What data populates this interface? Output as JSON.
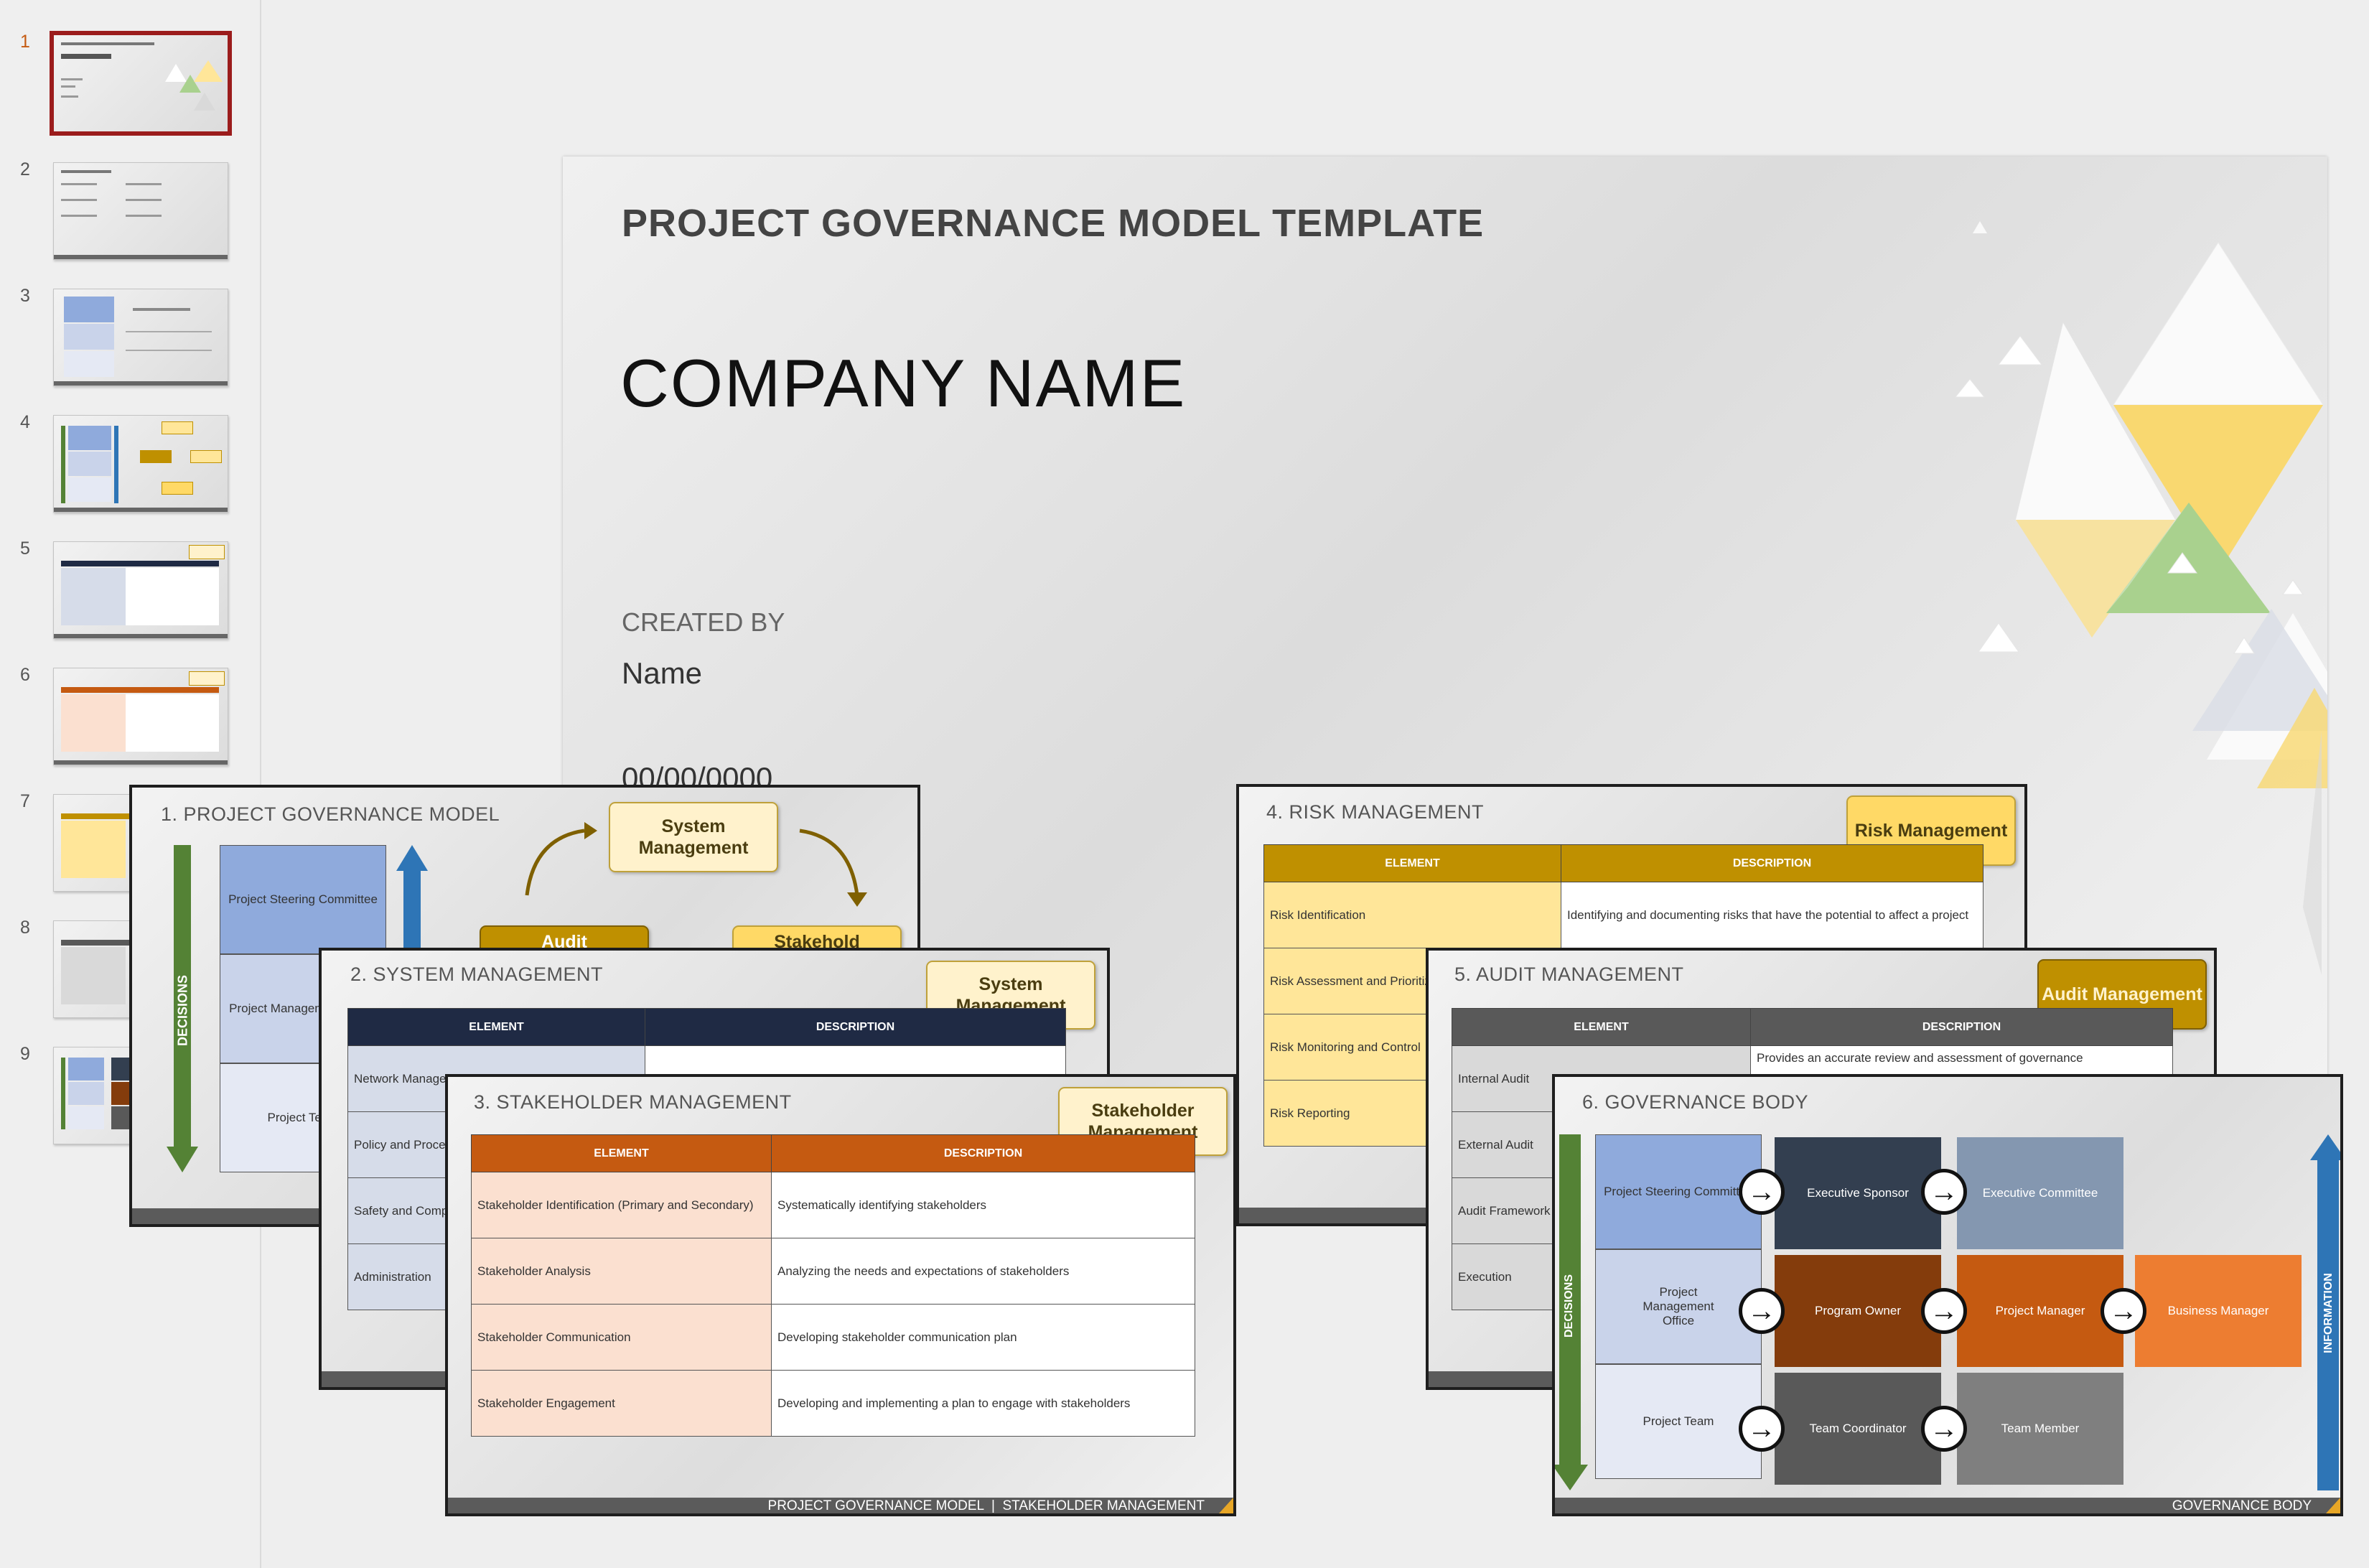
{
  "thumbnails": [
    {
      "num": "1",
      "selected": true,
      "title": "PROJECT GOVERNANCE MODEL TEMPLATE",
      "sub": "COMPANY NAME"
    },
    {
      "num": "2",
      "selected": false,
      "title": "TABLE OF CONTENTS"
    },
    {
      "num": "3",
      "selected": false,
      "title": "GOVERNANCE MODEL"
    },
    {
      "num": "4",
      "selected": false,
      "title": "PROJECT GOVERNANCE MODEL"
    },
    {
      "num": "5",
      "selected": false,
      "title": "SYSTEM MANAGEMENT"
    },
    {
      "num": "6",
      "selected": false,
      "title": "STAKEHOLDER MANAGEMENT"
    },
    {
      "num": "7",
      "selected": false,
      "title": "RISK MANAGEMENT"
    },
    {
      "num": "8",
      "selected": false,
      "title": "AUDIT MANAGEMENT"
    },
    {
      "num": "9",
      "selected": false,
      "title": "GOVERNANCE BODY"
    }
  ],
  "main_slide": {
    "title": "PROJECT GOVERNANCE MODEL TEMPLATE",
    "company": "COMPANY NAME",
    "created_by_label": "CREATED BY",
    "name": "Name",
    "date": "00/00/0000"
  },
  "s1": {
    "heading": "1. PROJECT GOVERNANCE MODEL",
    "decisions": "DECISIONS",
    "boxes": [
      "Project Steering Committee",
      "Project Management Office",
      "Project Team"
    ],
    "badge": "System Management",
    "gold1": "Audit",
    "gold2": "Stakehold"
  },
  "s2": {
    "heading": "2. SYSTEM MANAGEMENT",
    "badge": "System Management",
    "col1": "ELEMENT",
    "col2": "DESCRIPTION",
    "rows": [
      "Network Management",
      "Policy and Procedures",
      "Safety and Compliance",
      "Administration"
    ]
  },
  "s3": {
    "heading": "3. STAKEHOLDER MANAGEMENT",
    "badge": "Stakeholder Management",
    "col1": "ELEMENT",
    "col2": "DESCRIPTION",
    "rows": [
      {
        "e": "Stakeholder Identification (Primary and Secondary)",
        "d": "Systematically identifying stakeholders"
      },
      {
        "e": "Stakeholder Analysis",
        "d": "Analyzing the needs and expectations of stakeholders"
      },
      {
        "e": "Stakeholder Communication",
        "d": "Developing stakeholder communication plan"
      },
      {
        "e": "Stakeholder Engagement",
        "d": "Developing and implementing a plan to engage with stakeholders"
      }
    ],
    "footer": "PROJECT GOVERNANCE MODEL  |  STAKEHOLDER MANAGEMENT"
  },
  "s4": {
    "heading": "4. RISK MANAGEMENT",
    "badge": "Risk Management",
    "col1": "ELEMENT",
    "col2": "DESCRIPTION",
    "rows": [
      {
        "e": "Risk Identification",
        "d": "Identifying and documenting risks that have the potential to affect a project"
      },
      {
        "e": "Risk Assessment and Prioritization",
        "d": ""
      },
      {
        "e": "Risk Monitoring and Control",
        "d": ""
      },
      {
        "e": "Risk Reporting",
        "d": ""
      }
    ]
  },
  "s5": {
    "heading": "5. AUDIT MANAGEMENT",
    "badge": "Audit Management",
    "col1": "ELEMENT",
    "col2": "DESCRIPTION",
    "rows": [
      {
        "e": "Internal Audit",
        "d": "Provides an accurate review and assessment of governance"
      },
      {
        "e": "External Audit",
        "d": ""
      },
      {
        "e": "Audit Framework",
        "d": ""
      },
      {
        "e": "Execution",
        "d": ""
      }
    ]
  },
  "s6": {
    "heading": "6. GOVERNANCE BODY",
    "decisions": "DECISIONS",
    "information": "INFORMATION",
    "left": [
      "Project Steering Committee",
      "Project Management Office",
      "Project Team"
    ],
    "r1": [
      "Executive Sponsor",
      "Executive Committee"
    ],
    "r2": [
      "Program Owner",
      "Project Manager",
      "Business Manager"
    ],
    "r3": [
      "Team Coordinator",
      "Team Member"
    ],
    "footer": "GOVERNANCE BODY"
  },
  "colors": {
    "green": "#548235",
    "blue": "#2e75b6",
    "navy": "#1f2a44",
    "orange": "#c55a11",
    "gold": "#bf9000",
    "gray": "#595959"
  }
}
